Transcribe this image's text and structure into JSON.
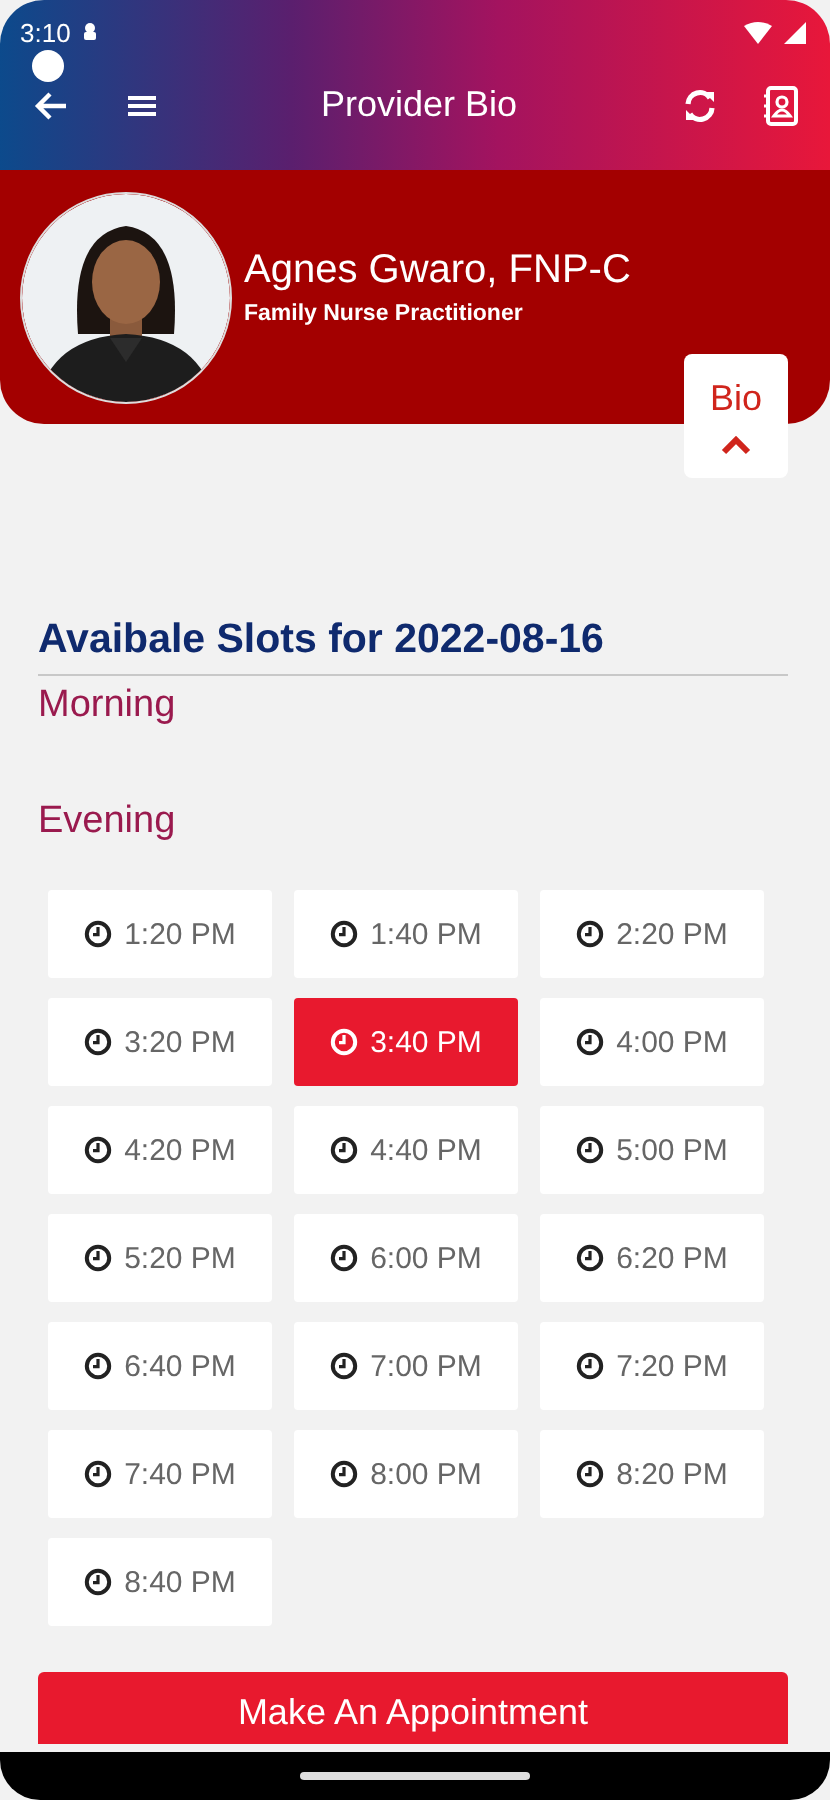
{
  "status_bar": {
    "time": "3:10"
  },
  "app_bar": {
    "title": "Provider Bio"
  },
  "provider": {
    "name": "Agnes Gwaro, FNP-C",
    "role": "Family Nurse Practitioner"
  },
  "bio_tab": {
    "label": "Bio",
    "expanded": false
  },
  "slots_title": "Avaibale Slots for 2022-08-16",
  "sections": [
    {
      "label": "Morning"
    },
    {
      "label": "Evening",
      "slots": [
        {
          "time": "1:20 PM",
          "selected": false
        },
        {
          "time": "1:40 PM",
          "selected": false
        },
        {
          "time": "2:20 PM",
          "selected": false
        },
        {
          "time": "3:20 PM",
          "selected": false
        },
        {
          "time": "3:40 PM",
          "selected": true
        },
        {
          "time": "4:00 PM",
          "selected": false
        },
        {
          "time": "4:20 PM",
          "selected": false
        },
        {
          "time": "4:40 PM",
          "selected": false
        },
        {
          "time": "5:00 PM",
          "selected": false
        },
        {
          "time": "5:20 PM",
          "selected": false
        },
        {
          "time": "6:00 PM",
          "selected": false
        },
        {
          "time": "6:20 PM",
          "selected": false
        },
        {
          "time": "6:40 PM",
          "selected": false
        },
        {
          "time": "7:00 PM",
          "selected": false
        },
        {
          "time": "7:20 PM",
          "selected": false
        },
        {
          "time": "7:40 PM",
          "selected": false
        },
        {
          "time": "8:00 PM",
          "selected": false
        },
        {
          "time": "8:20 PM",
          "selected": false
        },
        {
          "time": "8:40 PM",
          "selected": false
        }
      ]
    }
  ],
  "action_button": "Make An Appointment"
}
